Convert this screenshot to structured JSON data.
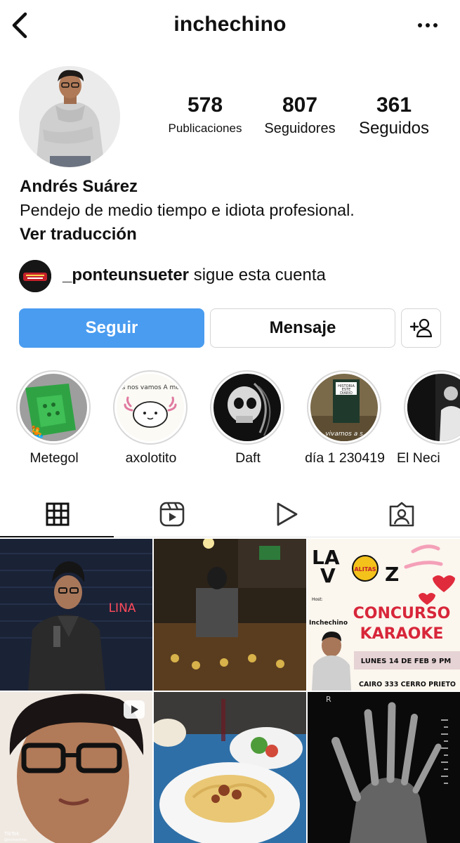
{
  "header": {
    "username": "inchechino",
    "back_icon": "chevron-left-icon",
    "more_icon": "more-horizontal-icon"
  },
  "profile": {
    "stats": {
      "posts": {
        "value": "578",
        "label": "Publicaciones"
      },
      "followers": {
        "value": "807",
        "label": "Seguidores"
      },
      "following": {
        "value": "361",
        "label": "Seguidos"
      }
    },
    "name": "Andrés Suárez",
    "bio": "Pendejo de medio tiempo e idiota profesional.",
    "translate_label": "Ver traducción",
    "followed_by": {
      "username": "_ponteunsueter",
      "suffix": " sigue esta cuenta"
    }
  },
  "actions": {
    "follow_label": "Seguir",
    "message_label": "Mensaje",
    "add_user_icon": "add-person-icon"
  },
  "highlights": [
    {
      "label": "Metegol"
    },
    {
      "label": "axolotito"
    },
    {
      "label": "Daft"
    },
    {
      "label": "día 1 230419"
    },
    {
      "label": "El Neci"
    }
  ],
  "tabs": [
    {
      "icon": "grid-icon",
      "active": true
    },
    {
      "icon": "reels-icon",
      "active": false
    },
    {
      "icon": "play-icon",
      "active": false
    },
    {
      "icon": "tagged-icon",
      "active": false
    }
  ],
  "posts": {
    "post_2_title_1": "LA",
    "post_2_title_2": "V",
    "post_2_title_3": "Z",
    "post_2_badge": "ALITAS",
    "post_2_host_label": "Host:",
    "post_2_host_name": "Inchechino",
    "post_2_event_1": "CONCURSO",
    "post_2_event_2": "KARAOKE",
    "post_2_date": "LUNES 14 DE FEB 9 PM",
    "post_2_address": "CAIRO 333 CERRO PRIETO",
    "post_0_sign": "LINA",
    "post_3_watermark": "TikTok",
    "post_3_handle": "@inchechino",
    "post_5_marker": "R",
    "highlight_1_text": "Todos nos vamos A morir :)",
    "highlight_3_book_1": "HISTORIA",
    "highlight_3_book_2": "ESTE",
    "highlight_3_book_3": "DIARIO",
    "highlight_3_caption": "vivamos a s"
  },
  "colors": {
    "follow_button": "#4a9cf0",
    "border": "#d5d5d5",
    "text": "#111111"
  }
}
